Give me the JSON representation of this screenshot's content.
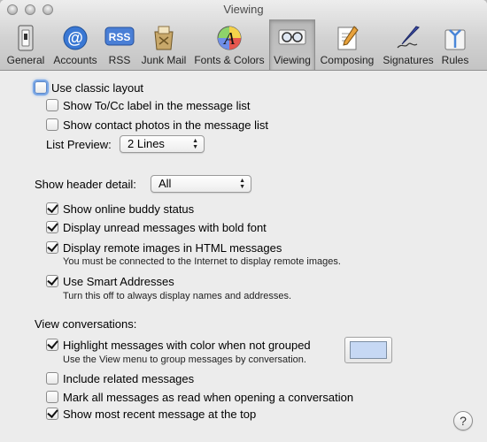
{
  "window": {
    "title": "Viewing"
  },
  "toolbar": {
    "items": [
      {
        "label": "General",
        "icon": "switch-icon"
      },
      {
        "label": "Accounts",
        "icon": "at-sign-icon"
      },
      {
        "label": "RSS",
        "icon": "rss-icon",
        "badge": "RSS"
      },
      {
        "label": "Junk Mail",
        "icon": "junk-bin-icon"
      },
      {
        "label": "Fonts & Colors",
        "icon": "fonts-colors-icon",
        "glyph": "A"
      },
      {
        "label": "Viewing",
        "icon": "glasses-icon",
        "selected": true
      },
      {
        "label": "Composing",
        "icon": "compose-pencil-icon"
      },
      {
        "label": "Signatures",
        "icon": "signature-pen-icon"
      },
      {
        "label": "Rules",
        "icon": "rules-arrows-icon"
      }
    ]
  },
  "layout_section": {
    "classic_layout": {
      "label": "Use classic layout",
      "checked": false,
      "focused": true
    },
    "show_tocc": {
      "label": "Show To/Cc label in the message list",
      "checked": false
    },
    "show_contact_photos": {
      "label": "Show contact photos in the message list",
      "checked": false
    },
    "list_preview": {
      "label": "List Preview:",
      "value": "2 Lines"
    }
  },
  "header_section": {
    "header_detail": {
      "label": "Show header detail:",
      "value": "All"
    },
    "buddy_status": {
      "label": "Show online buddy status",
      "checked": true
    },
    "bold_unread": {
      "label": "Display unread messages with bold font",
      "checked": true
    },
    "remote_images": {
      "label": "Display remote images in HTML messages",
      "checked": true,
      "note": "You must be connected to the Internet to display remote images."
    },
    "smart_addresses": {
      "label": "Use Smart Addresses",
      "checked": true,
      "note": "Turn this off to always display names and addresses."
    }
  },
  "conversations_section": {
    "heading": "View conversations:",
    "highlight": {
      "label": "Highlight messages with color when not grouped",
      "checked": true,
      "note": "Use the View menu to group messages by conversation.",
      "color": "#c6d8f4"
    },
    "include_related": {
      "label": "Include related messages",
      "checked": false
    },
    "mark_read": {
      "label": "Mark all messages as read when opening a conversation",
      "checked": false
    },
    "most_recent_top": {
      "label": "Show most recent message at the top",
      "checked": true
    }
  },
  "help": {
    "label": "?"
  }
}
